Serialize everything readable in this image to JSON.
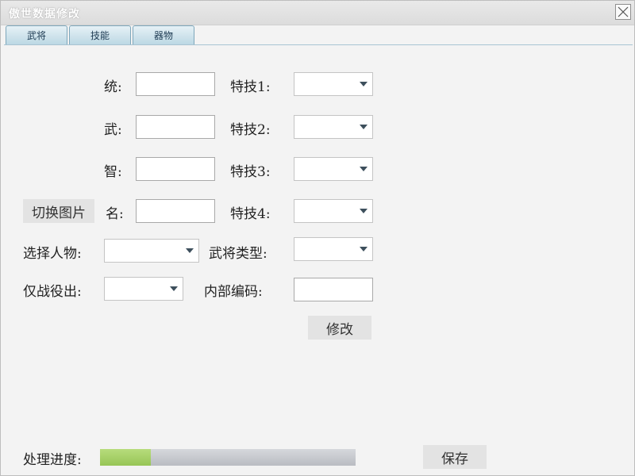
{
  "window": {
    "title": "傲世数据修改"
  },
  "tabs": [
    {
      "label": "武将"
    },
    {
      "label": "技能"
    },
    {
      "label": "器物"
    }
  ],
  "form": {
    "tong_label": "统:",
    "wu_label": "武:",
    "zhi_label": "智:",
    "ming_label": "名:",
    "skill1_label": "特技1:",
    "skill2_label": "特技2:",
    "skill3_label": "特技3:",
    "skill4_label": "特技4:",
    "select_person_label": "选择人物:",
    "general_type_label": "武将类型:",
    "battle_only_label": "仅战役出:",
    "internal_code_label": "内部编码:",
    "switch_image_button": "切换图片",
    "modify_button": "修改",
    "tong_value": "",
    "wu_value": "",
    "zhi_value": "",
    "ming_value": "",
    "internal_code_value": "",
    "skill1_value": "",
    "skill2_value": "",
    "skill3_value": "",
    "skill4_value": "",
    "select_person_value": "",
    "general_type_value": "",
    "battle_only_value": ""
  },
  "footer": {
    "progress_label": "处理进度:",
    "progress_value": 0.2,
    "save_button": "保存"
  },
  "colors": {
    "progress_fill": "#a6d066",
    "progress_track": "#c4c7cc",
    "tab_border": "#7ea7bb"
  },
  "icons": {
    "close": "close-icon",
    "dropdown": "chevron-down-icon"
  }
}
